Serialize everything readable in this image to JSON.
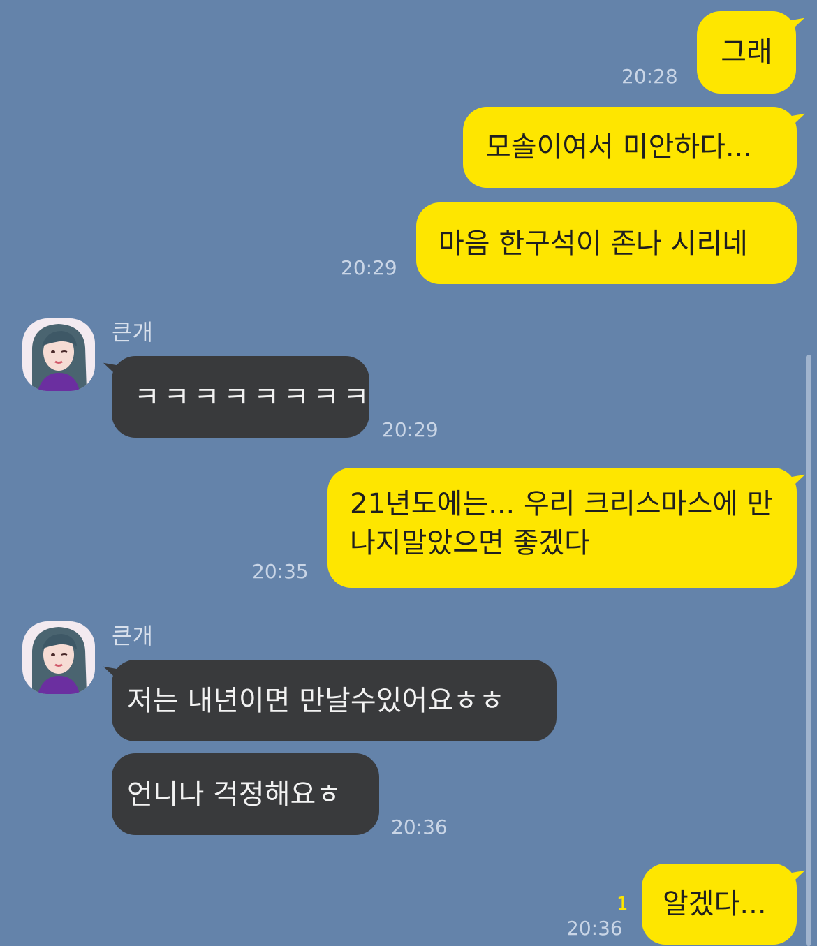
{
  "colors": {
    "background": "#6483aa",
    "my_bubble": "#fee600",
    "other_bubble": "#393a3c"
  },
  "messages": [
    {
      "from": "me",
      "text": "그래",
      "time": "20:28"
    },
    {
      "from": "me",
      "text": "모솔이여서 미안하다..."
    },
    {
      "from": "me",
      "text": "마음 한구석이 존나 시리네",
      "time": "20:29"
    },
    {
      "from": "other",
      "sender": "큰개",
      "text": "ㅋㅋㅋㅋㅋㅋㅋㅋ",
      "time": "20:29"
    },
    {
      "from": "me",
      "text": "21년도에는... 우리 크리스마스에 만나지말았으면 좋겠다",
      "time": "20:35"
    },
    {
      "from": "other",
      "sender": "큰개",
      "text": "저는 내년이면 만날수있어요ㅎㅎ"
    },
    {
      "from": "other",
      "text": "언니나 걱정해요ㅎ",
      "time": "20:36"
    },
    {
      "from": "me",
      "text": "알겠다...",
      "time": "20:36",
      "unread": "1"
    }
  ],
  "avatar_icon": "profile-photo"
}
